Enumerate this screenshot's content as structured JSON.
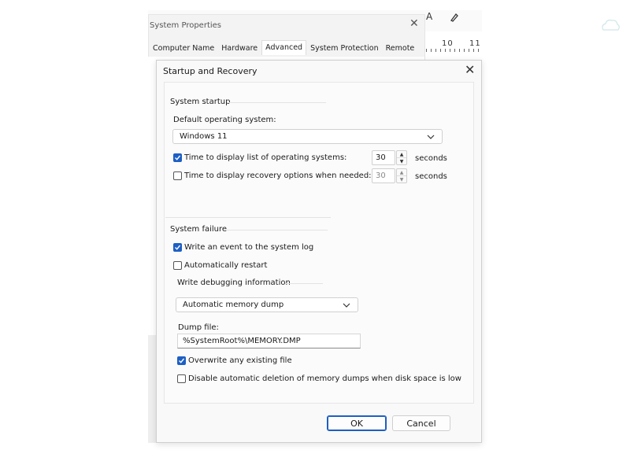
{
  "background": {
    "ruler_labels": [
      "10",
      "11"
    ],
    "toolbar_icons": [
      "text-color-icon",
      "highlighter-icon"
    ],
    "toolbar_glyph": "A"
  },
  "system_properties": {
    "title": "System Properties",
    "tabs": [
      "Computer Name",
      "Hardware",
      "Advanced",
      "System Protection",
      "Remote"
    ],
    "active_tab": "Advanced"
  },
  "dialog": {
    "title": "Startup and Recovery",
    "system_startup": {
      "heading": "System startup",
      "default_os_label": "Default operating system:",
      "default_os_value": "Windows 11",
      "show_os_list": {
        "label": "Time to display list of operating systems:",
        "checked": true,
        "value": "30",
        "unit": "seconds"
      },
      "show_recovery": {
        "label": "Time to display recovery options when needed:",
        "checked": false,
        "value": "30",
        "unit": "seconds"
      }
    },
    "system_failure": {
      "heading": "System failure",
      "write_event": {
        "label": "Write an event to the system log",
        "checked": true
      },
      "auto_restart": {
        "label": "Automatically restart",
        "checked": false
      },
      "debug_heading": "Write debugging information",
      "debug_type": "Automatic memory dump",
      "dump_file_label": "Dump file:",
      "dump_file_value": "%SystemRoot%\\MEMORY.DMP",
      "overwrite": {
        "label": "Overwrite any existing file",
        "checked": true
      },
      "disable_auto_delete": {
        "label": "Disable automatic deletion of memory dumps when disk space is low",
        "checked": false
      }
    },
    "buttons": {
      "ok": "OK",
      "cancel": "Cancel"
    }
  },
  "colors": {
    "accent": "#1d5fc4",
    "dialog_bg": "#f9f9f9"
  }
}
